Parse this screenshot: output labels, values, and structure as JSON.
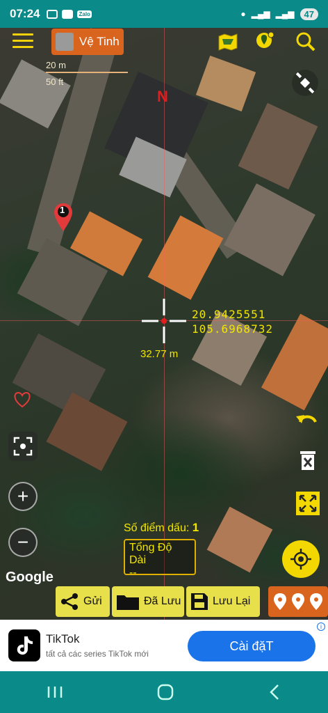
{
  "status": {
    "time": "07:24",
    "battery": "47",
    "zalo_label": "Zalo"
  },
  "toolbar": {
    "map_type_label": "Vệ Tinh"
  },
  "map": {
    "scale_m": "20 m",
    "scale_ft": "50 ft",
    "north_label": "N",
    "pin_number": "1",
    "lat": "20.9425551",
    "lng": "105.6968732",
    "distance": "32.77 m",
    "marker_count_label": "Số điểm dấu:",
    "marker_count": "1",
    "total_length_label": "Tổng Độ Dài",
    "total_length_value": "--",
    "attribution": "Google"
  },
  "bottom_bar": {
    "send": "Gửi",
    "saved": "Đã Lưu",
    "save": "Lưu Lại"
  },
  "ad": {
    "title": "TikTok",
    "subtitle": "tất cả các series TikTok mới",
    "cta": "Cài đặT"
  },
  "colors": {
    "status_bar": "#0a8a88",
    "accent_yellow": "#f2d800",
    "accent_orange": "#d9641e"
  }
}
